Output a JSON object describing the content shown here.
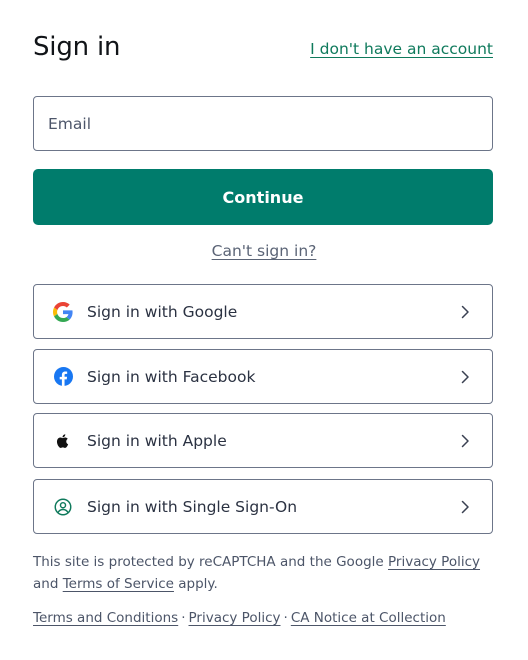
{
  "header": {
    "title": "Sign in",
    "no_account_link": "I don't have an account"
  },
  "form": {
    "email_placeholder": "Email",
    "email_value": "",
    "continue_label": "Continue",
    "cant_sign_in_label": "Can't sign in?"
  },
  "providers": [
    {
      "label": "Sign in with Google",
      "icon": "google-icon"
    },
    {
      "label": "Sign in with Facebook",
      "icon": "facebook-icon"
    },
    {
      "label": "Sign in with Apple",
      "icon": "apple-icon"
    },
    {
      "label": "Sign in with Single Sign-On",
      "icon": "sso-user-icon"
    }
  ],
  "recaptcha": {
    "prefix": "This site is protected by reCAPTCHA and the Google ",
    "privacy_policy": "Privacy Policy",
    "middle": " and ",
    "terms_of_service": "Terms of Service",
    "suffix": " apply."
  },
  "footer": {
    "terms": "Terms and Conditions",
    "privacy": "Privacy Policy",
    "ca_notice": "CA Notice at Collection",
    "separator": "·"
  },
  "colors": {
    "primary": "#007c6c",
    "link_green": "#0f7a5c",
    "border": "#6c7589",
    "muted_text": "#4c5568"
  }
}
